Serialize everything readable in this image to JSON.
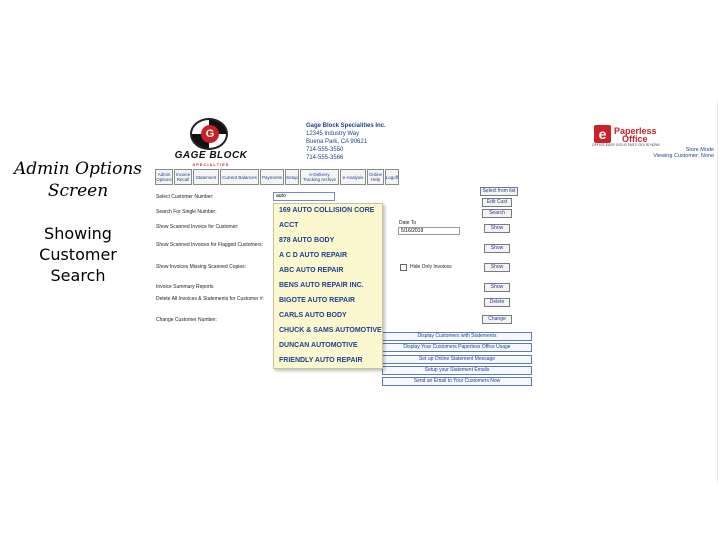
{
  "slide": {
    "title_line1": "Admin Options",
    "title_line2": "Screen",
    "subtitle_line1": "Showing",
    "subtitle_line2": "Customer",
    "subtitle_line3": "Search"
  },
  "company": {
    "logo_text": "GAGE BLOCK",
    "logo_sub": "SPECIALTIES",
    "logo_letter": "G",
    "address_lines": [
      "Gage Block Specialities Inc.",
      "12345 Industry Way",
      "Buena Park, CA 90621",
      "714-555-3550",
      "714-555-3566"
    ]
  },
  "paperless": {
    "e_letter": "e",
    "name_line1": "Paperless",
    "name_line2": "Office",
    "tagline": "OFFICE EASY GO! IS FAST! GO! IS NOW!",
    "store_mode": "Store Mode",
    "viewing": "Viewing Customer: None"
  },
  "tabs": [
    {
      "label": "Admin Options"
    },
    {
      "label": "Invoice Recall"
    },
    {
      "label": "Statement"
    },
    {
      "label": "Current Balances"
    },
    {
      "label": "Payments"
    },
    {
      "label": "Setup"
    },
    {
      "label": "e-Delivery Tracking Archive"
    },
    {
      "label": "e-Analysis"
    },
    {
      "label": "Online Help"
    },
    {
      "label": "Logoff"
    }
  ],
  "form": {
    "labels": [
      "Select Customer Number:",
      "Search For Single Number:",
      "Show Scanned Invoice for Customer:",
      "Show Scanned Invoices for Flagged Customers:",
      "Show Invoices Missing Scanned Copies:",
      "Invoice Summary Reports",
      "Delete All Invoices & Statements for Customer #:",
      "Change Customer Number:"
    ],
    "customer_value": "auto",
    "date_to_label": "Date To",
    "date_to_value": "5/16/2019",
    "hide_label": "Hide Only Invoices"
  },
  "dropdown": {
    "items": [
      "169 AUTO COLLISION CORE",
      "ACCT",
      "878 AUTO BODY",
      "A C D AUTO REPAIR",
      "ABC AUTO REPAIR",
      "BENS AUTO REPAIR INC.",
      "BIGOTE AUTO REPAIR",
      "CARLS AUTO BODY",
      "CHUCK & SAMS AUTOMOTIVE",
      "DUNCAN AUTOMOTIVE",
      "FRIENDLY AUTO REPAIR"
    ]
  },
  "buttons": {
    "select_list": "Select from list",
    "edit_cust": "Edit Cust",
    "search": "Search",
    "show1": "Show",
    "show2": "Show",
    "show3": "Show",
    "show4": "Show",
    "delete": "Delete",
    "change": "Change"
  },
  "actions": [
    "Display Customers with Statements",
    "Display Your Customers Paperless Office Usage",
    "Set up Online Statement Message",
    "Setup your Statement Emails",
    "Send an Email to Your Customers Now"
  ]
}
